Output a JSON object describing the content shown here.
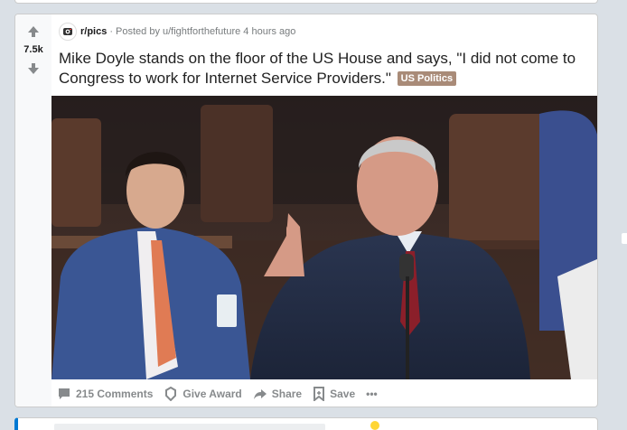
{
  "post": {
    "votes": "7.5k",
    "subreddit": "r/pics",
    "posted_by": "Posted by u/fightforthefuture",
    "time": "4 hours ago",
    "title": "Mike Doyle stands on the floor of the US House and says, \"I did not come to Congress to work for Internet Service Providers.\"",
    "flair": "US Politics",
    "flair_color": "#a98b78",
    "actions": {
      "comments": "215 Comments",
      "award": "Give Award",
      "share": "Share",
      "save": "Save",
      "more": "•••"
    }
  },
  "colors": {
    "background": "#dae0e6",
    "accent_blue": "#0079d3",
    "meta_gray": "#787c7e"
  },
  "icons": [
    "upvote-icon",
    "downvote-icon",
    "subreddit-icon",
    "comment-icon",
    "award-icon",
    "share-icon",
    "save-icon",
    "more-icon"
  ]
}
